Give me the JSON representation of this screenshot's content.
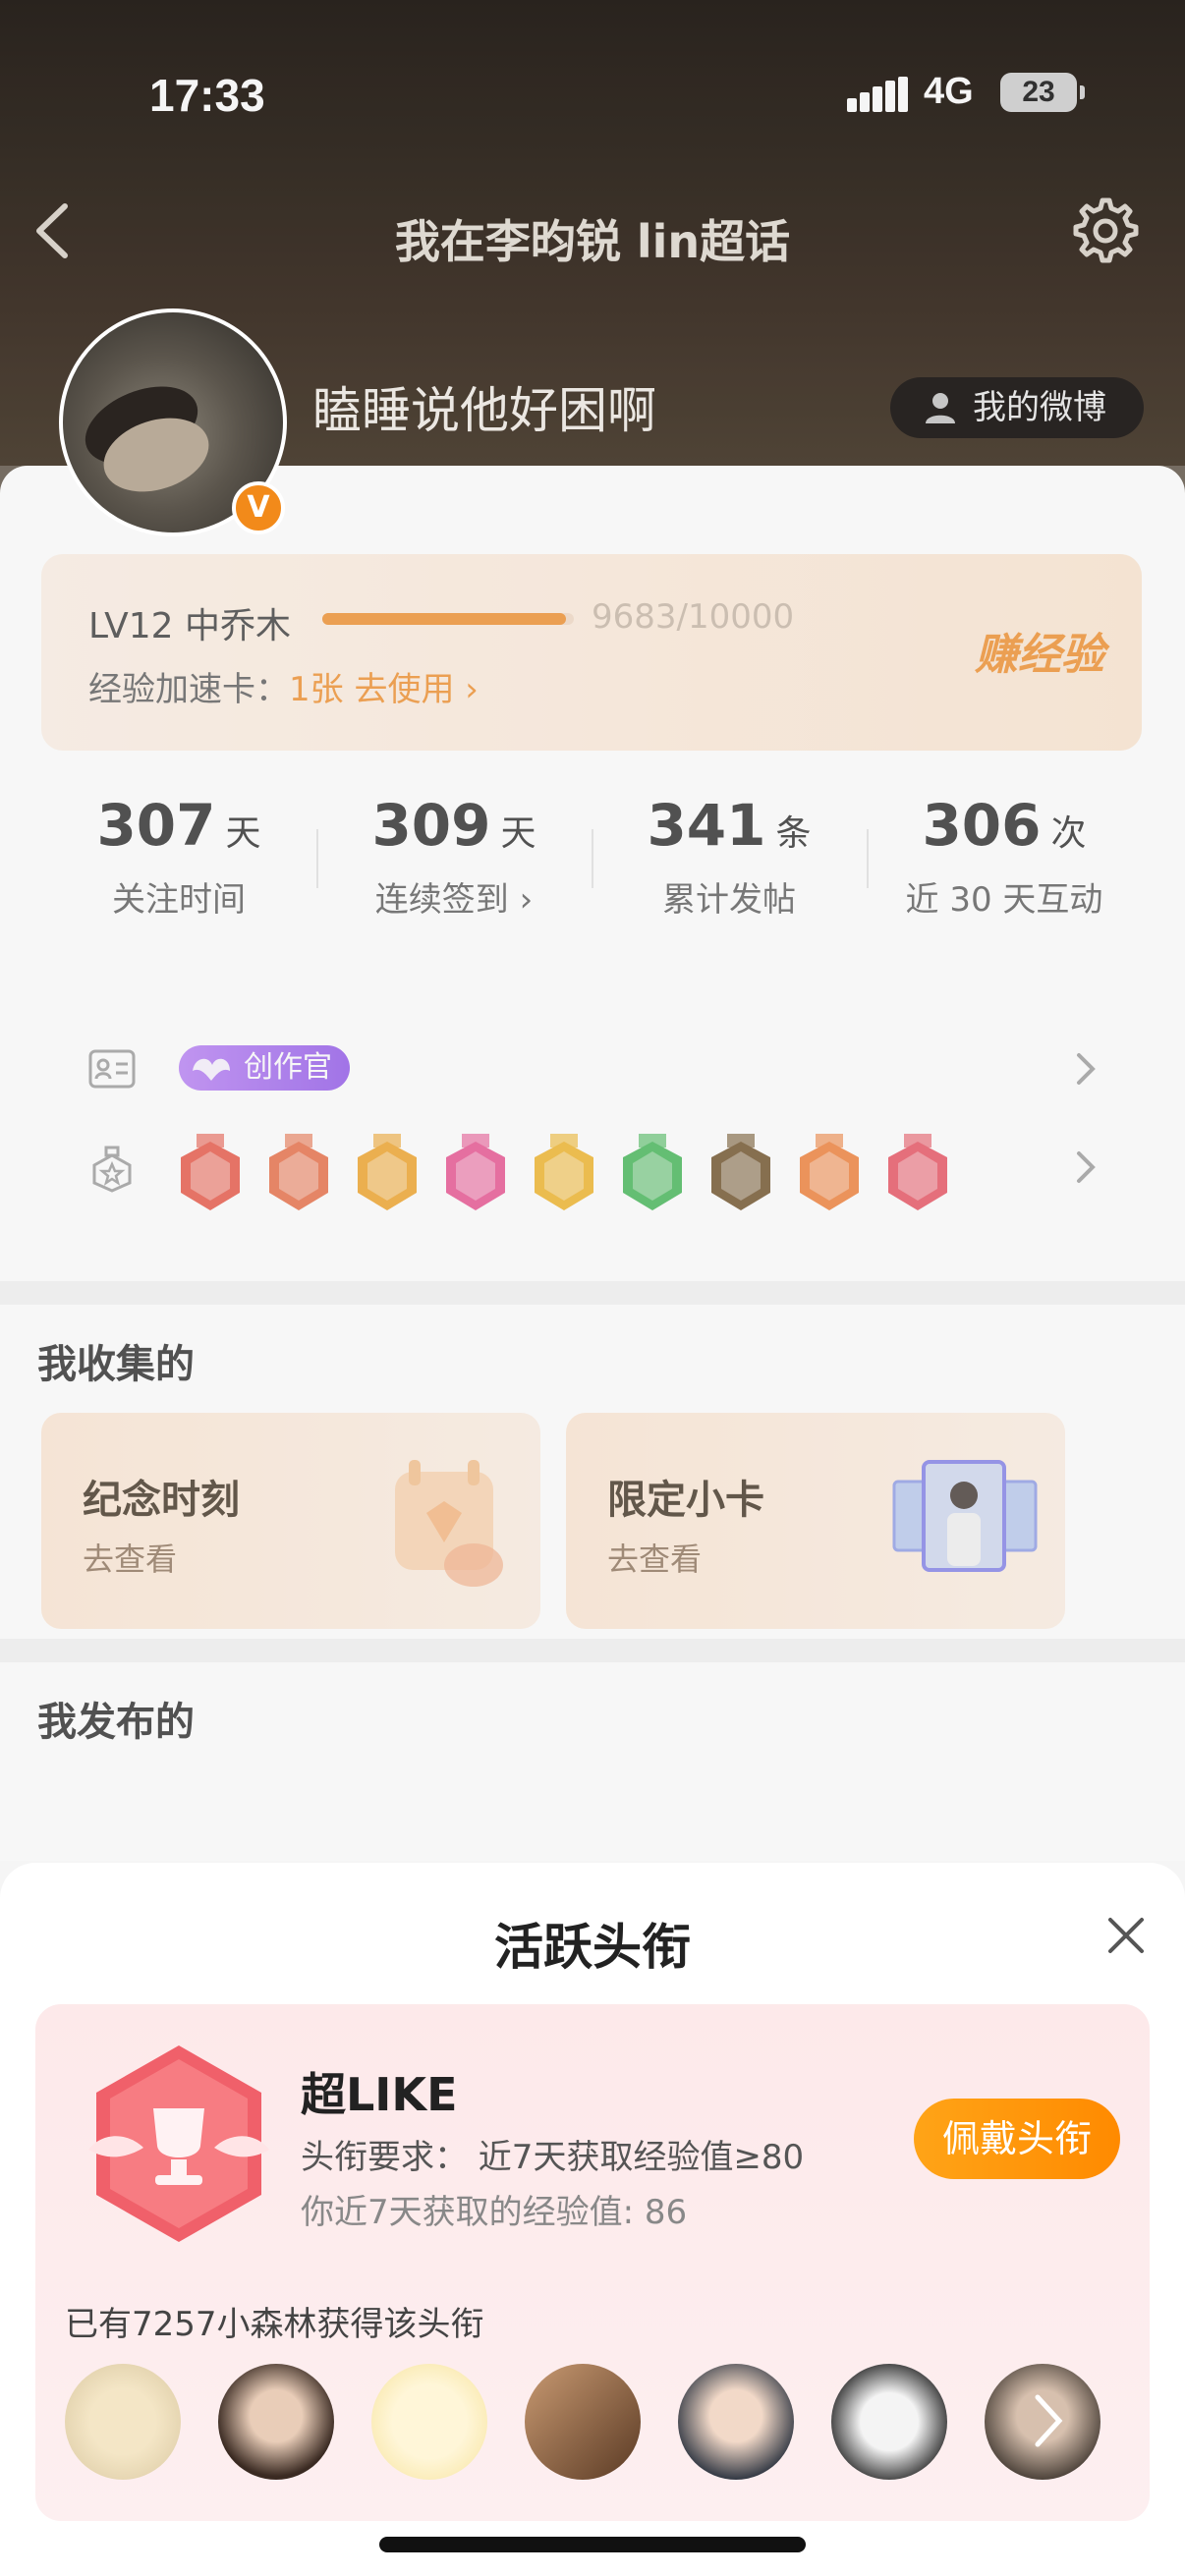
{
  "status_bar": {
    "time": "17:33",
    "network": "4G",
    "battery": "23"
  },
  "header": {
    "title": "我在李昀锐 lin超话"
  },
  "profile": {
    "username": "瞌睡说他好困啊",
    "weibo_button": "我的微博",
    "verified_mark": "V"
  },
  "level": {
    "label": "LV12 中乔木",
    "progress_text": "9683/10000",
    "progress_fraction": 0.9683,
    "speed_card_label": "经验加速卡：",
    "speed_card_count": "1张 去使用",
    "earn_label": "赚经验"
  },
  "stats": [
    {
      "value": "307",
      "unit": "天",
      "label": "关注时间"
    },
    {
      "value": "309",
      "unit": "天",
      "label": "连续签到 ›"
    },
    {
      "value": "341",
      "unit": "条",
      "label": "累计发帖"
    },
    {
      "value": "306",
      "unit": "次",
      "label": "近 30 天互动"
    }
  ],
  "identity": {
    "tag": "创作官"
  },
  "medals": [
    {
      "icon": "doll-medal-icon",
      "color": "#e8503e"
    },
    {
      "icon": "hand-medal-icon",
      "color": "#e8683e"
    },
    {
      "icon": "crown-medal-icon",
      "color": "#f0a020"
    },
    {
      "icon": "lv-medal-icon",
      "color": "#e84a8c"
    },
    {
      "icon": "hi-medal-icon",
      "color": "#f0b020"
    },
    {
      "icon": "heart-hand-medal-icon",
      "color": "#3cb450"
    },
    {
      "icon": "super-medal-icon",
      "color": "#6a4a20"
    },
    {
      "icon": "100days-medal-icon",
      "color": "#f07a30"
    },
    {
      "icon": "trophy-medal-icon",
      "color": "#e84a5a"
    }
  ],
  "collect": {
    "title": "我收集的",
    "tiles": [
      {
        "title": "纪念时刻",
        "sub": "去查看"
      },
      {
        "title": "限定小卡",
        "sub": "去查看"
      }
    ]
  },
  "posts": {
    "title": "我发布的"
  },
  "sheet": {
    "title": "活跃头衔",
    "badge_name": "超LIKE",
    "requirement": "头衔要求：  近7天获取经验值≥80",
    "mine": "你近7天获取的经验值: 86",
    "wear_button": "佩戴头衔",
    "owners_text": "已有7257小森林获得该头衔"
  },
  "colors": {
    "accent": "#f08a24",
    "creator_purple": "#9b5cf0",
    "wear_orange": "#ff9500"
  }
}
